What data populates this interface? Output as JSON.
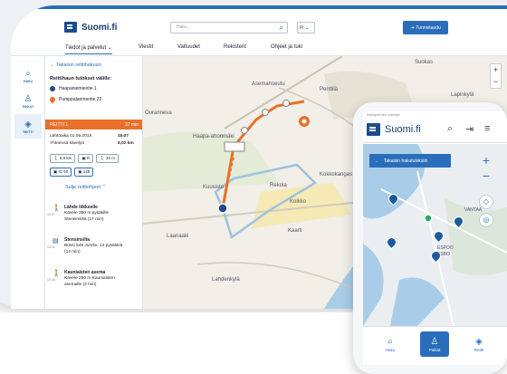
{
  "desktop": {
    "logo_text": "Suomi.fi",
    "search_placeholder": "Haku",
    "lang": "FI",
    "id_button_label": "Tunnistaudu",
    "nav": [
      "Tiedot ja palvelut",
      "Viestit",
      "Valtuudet",
      "Rekisterit",
      "Ohjeet ja tuki"
    ],
    "rail": [
      "HAKU",
      "PAIKAT",
      "REITTI"
    ],
    "panel": {
      "back_label": "Takaisin reittihakuun",
      "header": "Reittihaun tulokset välille:",
      "from": "Haapaniemientie 1",
      "to": "Pumppalanmentie 23",
      "route_label": "REITTI 1",
      "route_duration": "37 min",
      "depart_label": "Lähtöaika 01.06.2018",
      "depart_value": "15.07",
      "walk_label": "Yhteensä kävelyä",
      "walk_value": "6,02 km",
      "chips": [
        "6,0 km",
        "R",
        "20 m",
        "IC 50",
        "145"
      ],
      "close_label": "Sulje reittiohjeet",
      "steps": [
        {
          "time": "15.07",
          "title": "Lähde liikkeelle",
          "desc": "Kävele 350 m pysäkille Stensinsilta (17 min)"
        },
        {
          "time": "15.31",
          "title": "Stensinsilta",
          "desc": "Bussi 549 Jorvlin, 12 pysäkkiä (14 min)"
        },
        {
          "time": "15.48",
          "title": "Kauniaisten asema",
          "desc": "Kävele 250 m Kauniaisten asemalle (3 min)"
        }
      ]
    },
    "map_labels": [
      "Suokas",
      "Asemanseutu",
      "Penttilä",
      "Lapinkylä",
      "Ouranneva",
      "Haapa-ahonmäki",
      "Kuusisto",
      "Rekola",
      "Kokkokangas",
      "Laanaaki",
      "Kolkko",
      "Kaarti",
      "Lahdenkylä"
    ]
  },
  "mobile": {
    "caption": "Karttapalvelun mahdisti",
    "logo_text": "Suomi.fi",
    "back_label": "Takaisin hakutuloksiin",
    "map_labels": [
      "ESPOO",
      "ESBO",
      "VANTAA"
    ],
    "bottom": [
      "Haku",
      "Paikat",
      "Reitti"
    ]
  },
  "colors": {
    "accent": "#2a6ebb",
    "route": "#e8702a",
    "dark": "#1b4c8c"
  }
}
